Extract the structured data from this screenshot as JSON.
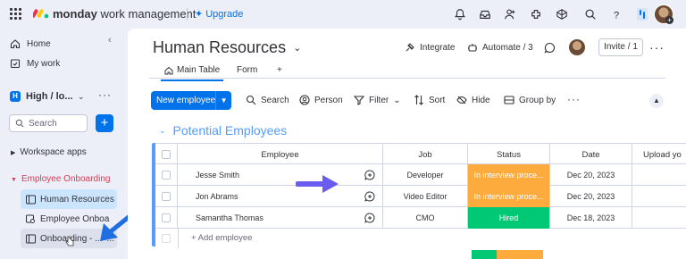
{
  "topbar": {
    "brand_bold": "monday",
    "brand_rest": " work management",
    "upgrade_label": "Upgrade",
    "icons": [
      "apps-grid-icon",
      "monday-logo",
      "bell-icon",
      "inbox-icon",
      "invite-members-icon",
      "integrations-icon",
      "marketplace-icon",
      "search-icon",
      "help-icon",
      "product-switcher-icon",
      "user-avatar"
    ]
  },
  "sidebar": {
    "home_label": "Home",
    "mywork_label": "My work",
    "workspace_badge": "H",
    "workspace_name": "High / lo...",
    "search_placeholder": "Search",
    "add_label": "+",
    "workspace_apps_label": "Workspace apps",
    "folder_label": "Employee Onboarding",
    "boards": [
      {
        "label": "Human Resources",
        "active": true
      },
      {
        "label": "Employee Onboa",
        "active": false
      },
      {
        "label": "Onboarding - ...",
        "active": false
      }
    ],
    "more_label": "..."
  },
  "board": {
    "title": "Human Resources",
    "integrate_label": "Integrate",
    "automate_label": "Automate / 3",
    "invite_label": "Invite / 1",
    "tabs": [
      {
        "label": "Main Table"
      },
      {
        "label": "Form"
      },
      {
        "label": "+"
      }
    ]
  },
  "toolbar": {
    "new_label": "New employee",
    "search_label": "Search",
    "person_label": "Person",
    "filter_label": "Filter",
    "sort_label": "Sort",
    "hide_label": "Hide",
    "groupby_label": "Group by"
  },
  "group": {
    "title": "Potential Employees",
    "color": "#579bfc",
    "columns": [
      "Employee",
      "Job",
      "Status",
      "Date",
      "Upload yo"
    ],
    "rows": [
      {
        "employee": "Jesse Smith",
        "job": "Developer",
        "status": "In interview proce...",
        "status_color": "#fdab3d",
        "date": "Dec 20, 2023"
      },
      {
        "employee": "Jon Abrams",
        "job": "Video Editor",
        "status": "In interview proce...",
        "status_color": "#fdab3d",
        "date": "Dec 20, 2023"
      },
      {
        "employee": "Samantha Thomas",
        "job": "CMO",
        "status": "Hired",
        "status_color": "#00c875",
        "date": "Dec 18, 2023"
      }
    ],
    "add_label": "+ Add employee"
  },
  "colors": {
    "accent": "#0073ea",
    "status_working": "#fdab3d",
    "status_done": "#00c875",
    "annotation_blue": "#1f6fe0",
    "annotation_purple": "#6b5cf0"
  }
}
